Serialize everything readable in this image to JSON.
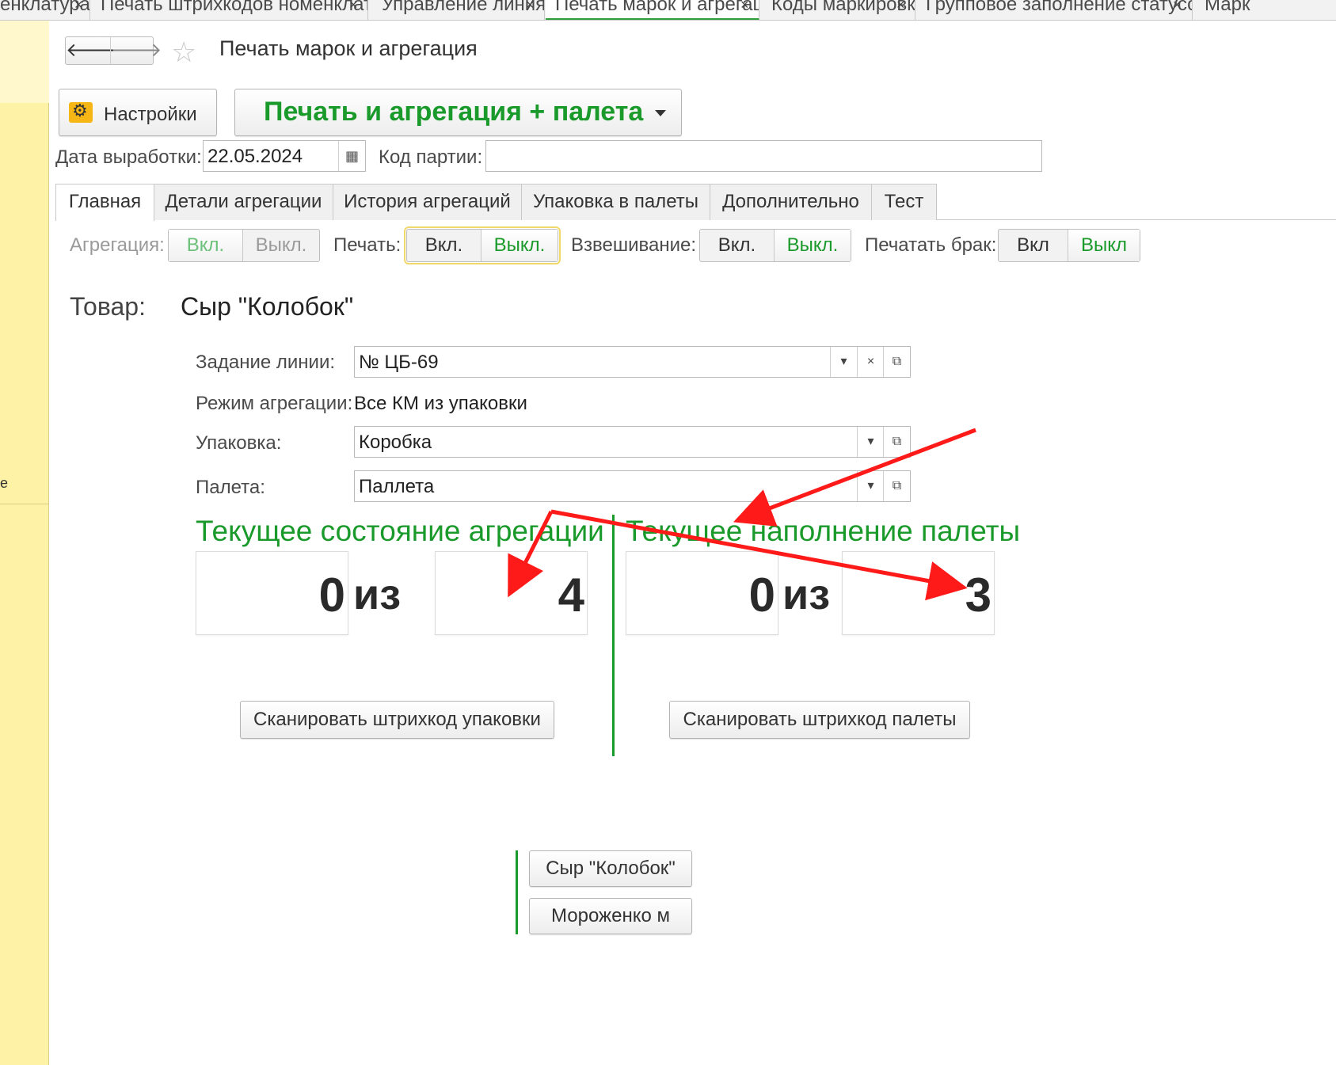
{
  "window_tabs": [
    {
      "label": "енклатура",
      "close": "×"
    },
    {
      "label": "Печать штрихкодов номенклатуры *",
      "close": "×"
    },
    {
      "label": "Управление линиями",
      "close": "×"
    },
    {
      "label": "Печать марок и агрегация",
      "close": "×"
    },
    {
      "label": "Коды маркировки",
      "close": "×"
    },
    {
      "label": "Групповое заполнение статусов КМ",
      "close": "×"
    },
    {
      "label": "Марк"
    }
  ],
  "left_panel": {
    "cut_text": "e"
  },
  "header": {
    "back_glyph": "🡐",
    "forward_glyph": "🡒",
    "favorite_glyph": "☆",
    "title": "Печать марок и агрегация"
  },
  "toolbar": {
    "settings_label": "Настройки",
    "settings_icon": "gear-folder-icon",
    "print_agg_label": "Печать и агрегация + палета"
  },
  "fields": {
    "production_date_label": "Дата выработки:",
    "production_date_value": "22.05.2024",
    "calendar_glyph": "▦",
    "batch_code_label": "Код партии:",
    "batch_code_value": ""
  },
  "tabs": [
    {
      "label": "Главная"
    },
    {
      "label": "Детали агрегации"
    },
    {
      "label": "История агрегаций"
    },
    {
      "label": "Упаковка в палеты"
    },
    {
      "label": "Дополнительно"
    },
    {
      "label": "Тест"
    }
  ],
  "toggles": [
    {
      "label": "Агрегация:",
      "on": "Вкл.",
      "off": "Выкл."
    },
    {
      "label": "Печать:",
      "on": "Вкл.",
      "off": "Выкл."
    },
    {
      "label": "Взвешивание:",
      "on": "Вкл.",
      "off": "Выкл."
    },
    {
      "label": "Печатать брак:",
      "on": "Вкл",
      "off": "Выкл"
    }
  ],
  "product": {
    "label": "Товар:",
    "value": "Сыр \"Колобок\""
  },
  "line_task": {
    "label": "Задание линии:",
    "value": "№ ЦБ-69",
    "dropdown_glyph": "▾",
    "clear_glyph": "×",
    "open_glyph": "⧉"
  },
  "agg_mode": {
    "label": "Режим агрегации:",
    "value": "Все КМ из упаковки"
  },
  "package": {
    "label": "Упаковка:",
    "value": "Коробка"
  },
  "pallet": {
    "label": "Палета:",
    "value": "Паллета"
  },
  "aggregation_state": {
    "title": "Текущее состояние агрегации",
    "current": "0",
    "of": "из",
    "total": "4"
  },
  "pallet_state": {
    "title": "Текущее наполнение палеты",
    "current": "0",
    "of": "из",
    "total": "3"
  },
  "buttons": {
    "scan_package": "Сканировать штрихкод упаковки",
    "scan_pallet": "Сканировать штрихкод палеты"
  },
  "product_buttons": [
    "Сыр \"Колобок\"",
    "Мороженко м"
  ],
  "colors": {
    "accent_green": "#1a9a2a",
    "annotation_red": "#ff1a1a",
    "panel_yellow": "#fdf2a6"
  }
}
